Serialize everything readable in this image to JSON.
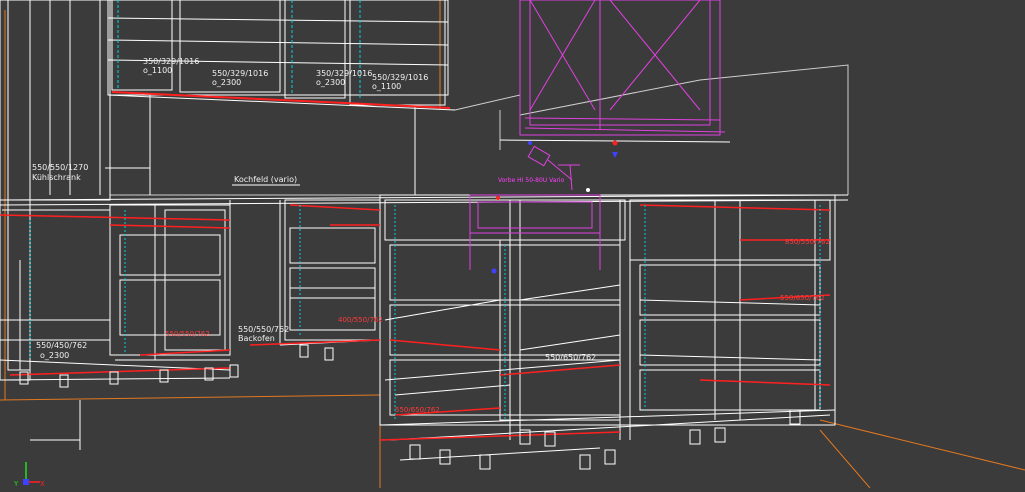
{
  "labels": {
    "wall_cab_1": "350/329/1016",
    "wall_cab_1_sub": "o_1100",
    "wall_cab_2": "550/329/1016",
    "wall_cab_2_sub": "o_2300",
    "wall_cab_3": "350/329/1016",
    "wall_cab_3_sub": "o_2300",
    "wall_cab_4": "550/329/1016",
    "wall_cab_4_sub": "o_1100",
    "fridge_dims": "550/550/1270",
    "fridge_name": "Kühlschrank",
    "hob": "Kochfeld (vario)",
    "sink": "Vorbe HI 50-80U Vario",
    "base_left_dims": "550/450/762",
    "base_left_sub": "o_2300",
    "oven_dims": "550/550/762",
    "oven_name": "Backofen",
    "base_mid_dims": "400/550/762",
    "corner_red_1": "850/550/762",
    "corner_red_2": "550/650/762",
    "corner_white": "550/650/762",
    "island_dims": "550/650/762"
  },
  "colors": {
    "background": "#3b3b3b",
    "wireframe": "#ffffff",
    "highlight": "#ff2020",
    "selection": "#e040e0",
    "dimension": "#00d0e0",
    "floor": "#e07820"
  },
  "axis": {
    "y": "Y",
    "x": "X"
  }
}
